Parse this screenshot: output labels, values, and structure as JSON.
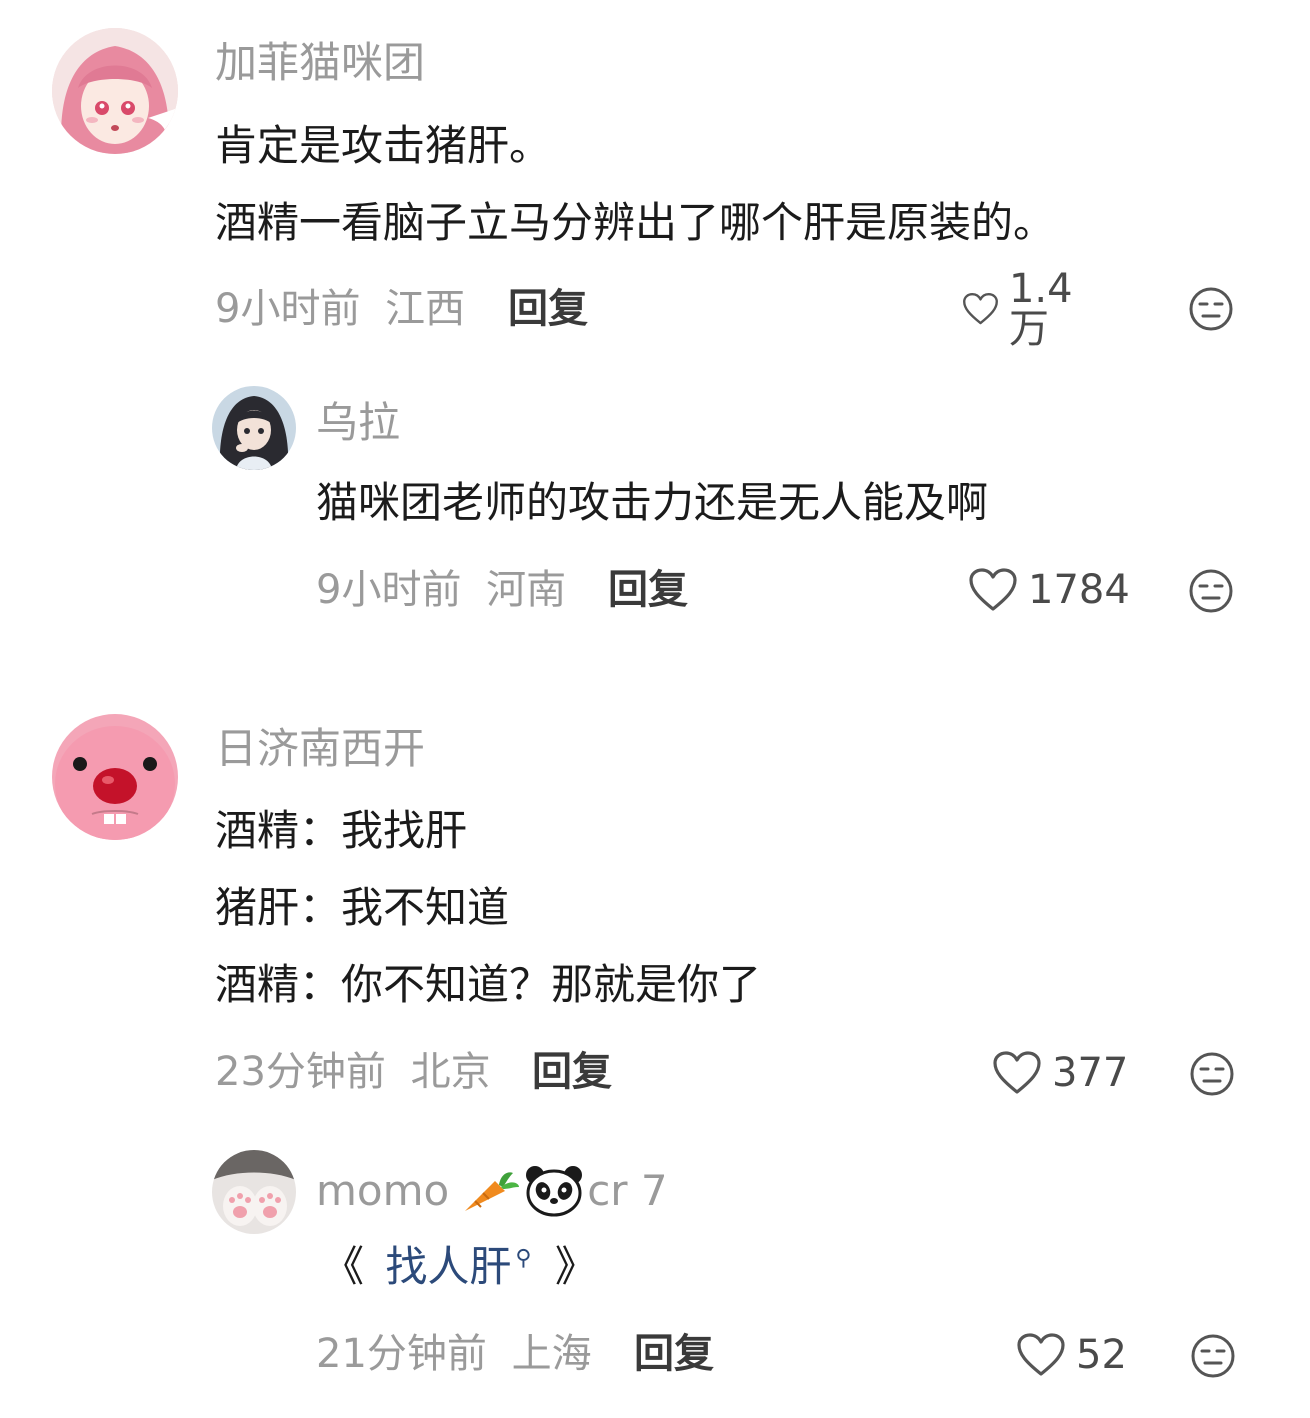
{
  "comments": [
    {
      "username": "加菲猫咪团",
      "lines": [
        "肯定是攻击猪肝。",
        "酒精一看脑子立马分辨出了哪个肝是原装的。"
      ],
      "time": "9小时前",
      "location": "江西",
      "reply_label": "回复",
      "likes": "1.4万",
      "replies": [
        {
          "username": "乌拉",
          "lines": [
            "猫咪团老师的攻击力还是无人能及啊"
          ],
          "time": "9小时前",
          "location": "河南",
          "reply_label": "回复",
          "likes": "1784"
        }
      ]
    },
    {
      "username": "日济南西开",
      "lines": [
        "酒精：我找肝",
        "猪肝：我不知道",
        "酒精：你不知道？那就是你了"
      ],
      "time": "23分钟前",
      "location": "北京",
      "reply_label": "回复",
      "likes": "377",
      "replies": [
        {
          "username_prefix": "momo",
          "username_suffix": "cr 7",
          "emoji": [
            "carrot-emoji",
            "panda-emoji"
          ],
          "line_open": "《",
          "link_text": "找人肝",
          "line_close": "》",
          "time": "21分钟前",
          "location": "上海",
          "reply_label": "回复",
          "likes": "52"
        }
      ]
    }
  ],
  "colors": {
    "meta_gray": "#9a9a9a",
    "text_dark": "#1b1b1b",
    "link_blue": "#2c4a7a"
  }
}
